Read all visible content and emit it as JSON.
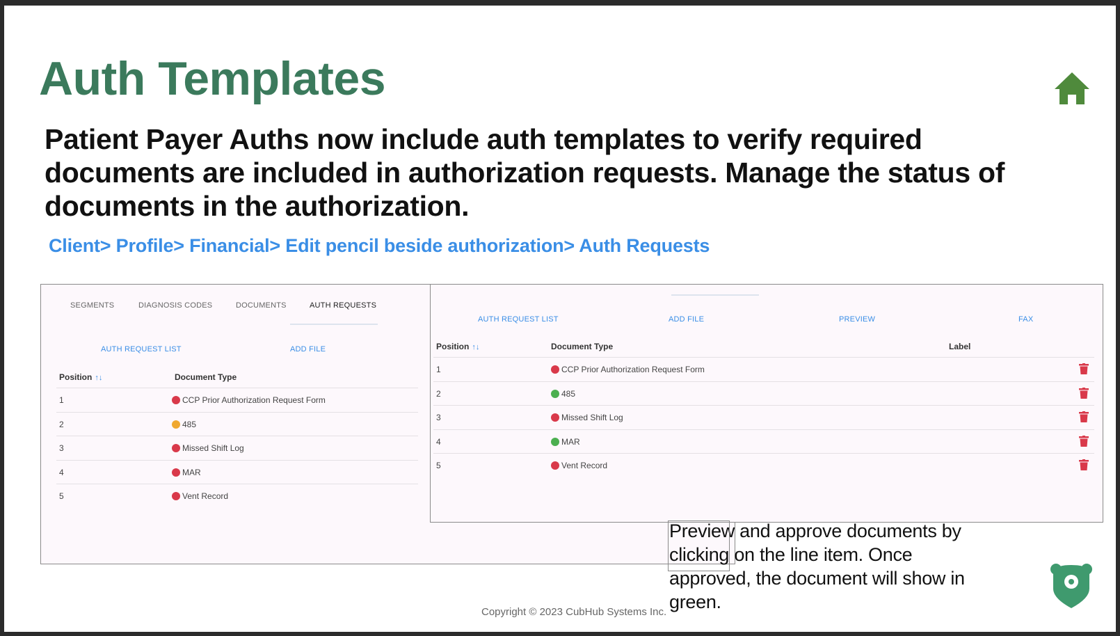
{
  "slide": {
    "title": "Auth Templates",
    "description": "Patient Payer Auths now include auth templates to verify required documents are included in authorization requests.  Manage the status of documents in the authorization.",
    "breadcrumb": "Client> Profile> Financial> Edit pencil beside authorization> Auth Requests",
    "note": "Preview and approve documents by clicking on the line item. Once approved, the document will show in green.",
    "copyright": "Copyright © 2023 CubHub Systems Inc.",
    "icons": {
      "home": "home-icon",
      "logo": "cubhub-logo-icon",
      "trash": "trash-icon"
    },
    "colors": {
      "title": "#3b7a5c",
      "link": "#3a8ee6",
      "status_red": "#d9394a",
      "status_orange": "#f0a830",
      "status_green": "#4caf50",
      "trash": "#d9394a"
    }
  },
  "left_panel": {
    "tabs": [
      "SEGMENTS",
      "DIAGNOSIS CODES",
      "DOCUMENTS",
      "AUTH REQUESTS"
    ],
    "active_tab": "AUTH REQUESTS",
    "actions": [
      "AUTH REQUEST LIST",
      "ADD FILE"
    ],
    "columns": {
      "position": "Position",
      "document_type": "Document Type"
    },
    "sort_icon": "↑↓",
    "rows": [
      {
        "position": "1",
        "document_type": "CCP Prior Authorization Request Form",
        "status": "red"
      },
      {
        "position": "2",
        "document_type": "485",
        "status": "orange"
      },
      {
        "position": "3",
        "document_type": "Missed Shift Log",
        "status": "red"
      },
      {
        "position": "4",
        "document_type": "MAR",
        "status": "red"
      },
      {
        "position": "5",
        "document_type": "Vent Record",
        "status": "red"
      }
    ]
  },
  "right_panel": {
    "actions": [
      "AUTH REQUEST LIST",
      "ADD FILE",
      "PREVIEW",
      "FAX"
    ],
    "columns": {
      "position": "Position",
      "document_type": "Document Type",
      "label": "Label"
    },
    "sort_icon": "↑↓",
    "rows": [
      {
        "position": "1",
        "document_type": "CCP Prior Authorization Request Form",
        "status": "red"
      },
      {
        "position": "2",
        "document_type": "485",
        "status": "green"
      },
      {
        "position": "3",
        "document_type": "Missed Shift Log",
        "status": "red"
      },
      {
        "position": "4",
        "document_type": "MAR",
        "status": "green"
      },
      {
        "position": "5",
        "document_type": "Vent Record",
        "status": "red"
      }
    ]
  }
}
